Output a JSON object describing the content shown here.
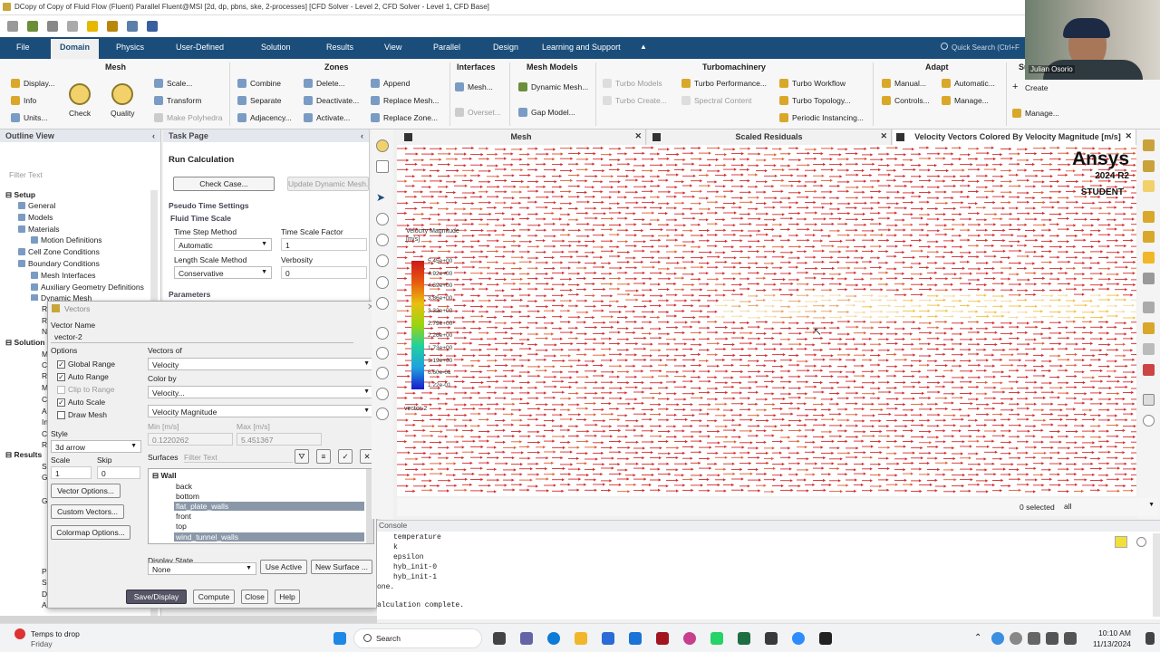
{
  "window": {
    "title": "DCopy of Copy of Fluid Flow (Fluent) Parallel Fluent@MSI  [2d, dp, pbns, ske, 2-processes] [CFD Solver - Level 2, CFD Solver - Level 1, CFD Base]"
  },
  "menubar": {
    "items": [
      "File",
      "Domain",
      "Physics",
      "User-Defined",
      "Solution",
      "Results",
      "View",
      "Parallel",
      "Design",
      "Learning and Support"
    ],
    "active": "Domain",
    "collapse": "▲",
    "search_placeholder": "Quick Search (Ctrl+F"
  },
  "ribbon": {
    "groups": [
      "Mesh",
      "Zones",
      "Interfaces",
      "Mesh Models",
      "Turbomachinery",
      "Adapt",
      "Surface"
    ],
    "mesh": {
      "display": "Display...",
      "info": "Info",
      "units": "Units...",
      "check": "Check",
      "quality": "Quality",
      "scale": "Scale...",
      "transform": "Transform",
      "make_polyhedra": "Make Polyhedra"
    },
    "zones": {
      "combine": "Combine",
      "separate": "Separate",
      "adjacency": "Adjacency...",
      "delete": "Delete...",
      "deactivate": "Deactivate...",
      "activate": "Activate...",
      "append": "Append",
      "replace_mesh": "Replace Mesh...",
      "replace_zone": "Replace Zone..."
    },
    "interfaces": {
      "mesh": "Mesh...",
      "overset": "Overset..."
    },
    "mesh_models": {
      "dynamic_mesh": "Dynamic Mesh...",
      "gap_model": "Gap Model..."
    },
    "turbo": {
      "turbo_models": "Turbo Models",
      "turbo_create": "Turbo Create...",
      "turbo_performance": "Turbo Performance...",
      "spectral_content": "Spectral Content",
      "turbo_workflow": "Turbo Workflow",
      "turbo_topology": "Turbo Topology...",
      "periodic_instancing": "Periodic Instancing..."
    },
    "adapt": {
      "manual": "Manual...",
      "automatic": "Automatic...",
      "controls": "Controls...",
      "manage": "Manage..."
    },
    "surface": {
      "create": "Create",
      "manage": "Manage..."
    }
  },
  "outline": {
    "title": "Outline View",
    "filter_placeholder": "Filter Text",
    "setup_label": "Setup",
    "setup_items": [
      "General",
      "Models",
      "Materials",
      "Motion Definitions",
      "Cell Zone Conditions",
      "Boundary Conditions",
      "Mesh Interfaces",
      "Auxiliary Geometry Definitions",
      "Dynamic Mesh"
    ],
    "solution_label": "Solution",
    "results_label": "Results",
    "partial_letters": [
      "R",
      "R",
      "N",
      "M",
      "C",
      "R",
      "M",
      "C",
      "A",
      "In",
      "C",
      "R",
      "S",
      "G",
      "G",
      "P",
      "S",
      "D",
      "A"
    ]
  },
  "taskpage": {
    "title": "Task Page",
    "heading": "Run Calculation",
    "check_case": "Check Case...",
    "update_dynamic_mesh": "Update Dynamic Mesh...",
    "pseudo_time_settings": "Pseudo Time Settings",
    "fluid_time_scale": "Fluid Time Scale",
    "time_step_method_label": "Time Step Method",
    "time_step_method": "Automatic",
    "time_scale_factor_label": "Time Scale Factor",
    "time_scale_factor": "1",
    "length_scale_method_label": "Length Scale Method",
    "length_scale_method": "Conservative",
    "verbosity_label": "Verbosity",
    "verbosity": "0",
    "parameters": "Parameters"
  },
  "vectors_dialog": {
    "title": "Vectors",
    "vector_name_label": "Vector Name",
    "vector_name": "vector-2",
    "options_label": "Options",
    "options": [
      {
        "label": "Global Range",
        "checked": true,
        "enabled": true
      },
      {
        "label": "Auto Range",
        "checked": true,
        "enabled": true
      },
      {
        "label": "Clip to Range",
        "checked": false,
        "enabled": false
      },
      {
        "label": "Auto Scale",
        "checked": true,
        "enabled": true
      },
      {
        "label": "Draw Mesh",
        "checked": false,
        "enabled": true
      }
    ],
    "vectors_of_label": "Vectors of",
    "vectors_of": "Velocity",
    "color_by_label": "Color by",
    "color_by": "Velocity...",
    "color_by_sub": "Velocity Magnitude",
    "min_label": "Min [m/s]",
    "min": "0.1220262",
    "max_label": "Max [m/s]",
    "max": "5.451367",
    "style_label": "Style",
    "style": "3d arrow",
    "scale_label": "Scale",
    "scale": "1",
    "skip_label": "Skip",
    "skip": "0",
    "surfaces_label": "Surfaces",
    "surfaces_filter_placeholder": "Filter Text",
    "surface_group": "Wall",
    "surfaces": [
      {
        "name": "back",
        "selected": false
      },
      {
        "name": "bottom",
        "selected": false
      },
      {
        "name": "flat_plate_walls",
        "selected": true
      },
      {
        "name": "front",
        "selected": false
      },
      {
        "name": "top",
        "selected": false
      },
      {
        "name": "wind_tunnel_walls",
        "selected": true
      }
    ],
    "vector_options": "Vector Options...",
    "custom_vectors": "Custom Vectors...",
    "colormap_options": "Colormap Options...",
    "display_state_label": "Display State",
    "display_state": "None",
    "use_active": "Use Active",
    "new_surface": "New Surface ...",
    "buttons": {
      "save_display": "Save/Display",
      "compute": "Compute",
      "close": "Close",
      "help": "Help"
    }
  },
  "graphics_tabs": [
    "Mesh",
    "Scaled Residuals",
    "Velocity Vectors Colored By Velocity Magnitude [m/s]"
  ],
  "graphics": {
    "brand": "Ansys",
    "version": "2024 R2",
    "edition": "STUDENT",
    "legend_title": "Velocity Magnitude",
    "legend_unit": "[m/s]",
    "legend_values": [
      "5.45e+00",
      "4.92e+00",
      "4.39e+00",
      "3.86e+00",
      "3.32e+00",
      "2.79e+00",
      "2.26e+00",
      "1.73e+00",
      "1.19e+00",
      "6.60e-01",
      "1.22e-01"
    ],
    "legend_name": "vector-2",
    "colors": {
      "high": "#cc1a1a",
      "low": "#1a1acc"
    }
  },
  "selection_bar": {
    "count": "0 selected",
    "filter": "all"
  },
  "console": {
    "title": "Console",
    "lines": [
      "temperature",
      "k",
      "epsilon",
      "hyb_init-0",
      "hyb_init-1",
      "one.",
      "",
      "alculation complete."
    ]
  },
  "taskbar": {
    "weather": "Temps to drop",
    "weather_sub": "Friday",
    "search": "Search",
    "time": "10:10 AM",
    "date": "11/13/2024"
  },
  "webcam": {
    "name_label": "Julian Osorio"
  }
}
